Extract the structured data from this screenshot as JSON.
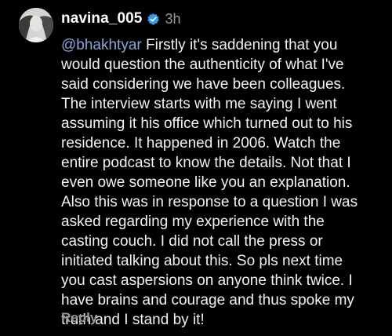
{
  "comment": {
    "username": "navina_005",
    "verified_icon": "verified-badge-icon",
    "time": "3h",
    "mention": "@bhakhtyar",
    "text_lines": [
      " Firstly it's saddening that you",
      "would question the authenticity of what I've",
      "said considering we have been colleagues.",
      "The interview starts with me saying I went",
      "assuming it his office which turned out to his",
      "residence. It happened in 2006. Watch the",
      "entire podcast to know the details. Not that I",
      "even owe someone like you an explanation.",
      "Also this was in response to a question I was",
      "asked regarding my experience with the",
      "casting couch. I did not call the press or",
      "initiated talking about this. So pls next time",
      "you cast aspersions on anyone think twice. I",
      "have brains and courage and thus spoke my",
      "truth and I stand by it!"
    ],
    "reply_label": "Reply"
  },
  "colors": {
    "background": "#000000",
    "text": "#f2f2f2",
    "mention": "#8aa6d6",
    "muted": "#9a9a9a",
    "verified": "#3897f0"
  }
}
